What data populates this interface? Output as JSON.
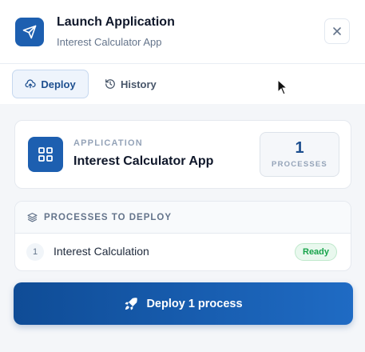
{
  "header": {
    "title": "Launch Application",
    "subtitle": "Interest Calculator App",
    "app_icon": "send-icon",
    "close_icon": "close-icon"
  },
  "tabs": [
    {
      "label": "Deploy",
      "icon": "cloud-upload-icon",
      "active": true
    },
    {
      "label": "History",
      "icon": "history-icon",
      "active": false
    }
  ],
  "application": {
    "section_label": "APPLICATION",
    "name": "Interest Calculator App",
    "icon": "grid-icon",
    "process_count": "1",
    "process_label": "PROCESSES"
  },
  "processes": {
    "heading": "PROCESSES TO DEPLOY",
    "heading_icon": "layers-icon",
    "items": [
      {
        "index": "1",
        "name": "Interest Calculation",
        "status": "Ready"
      }
    ]
  },
  "deploy_button": {
    "label": "Deploy 1 process",
    "icon": "rocket-icon"
  },
  "colors": {
    "accent": "#1d5fb0",
    "ready_text": "#16a34a",
    "ready_bg": "#e9f8ee"
  }
}
